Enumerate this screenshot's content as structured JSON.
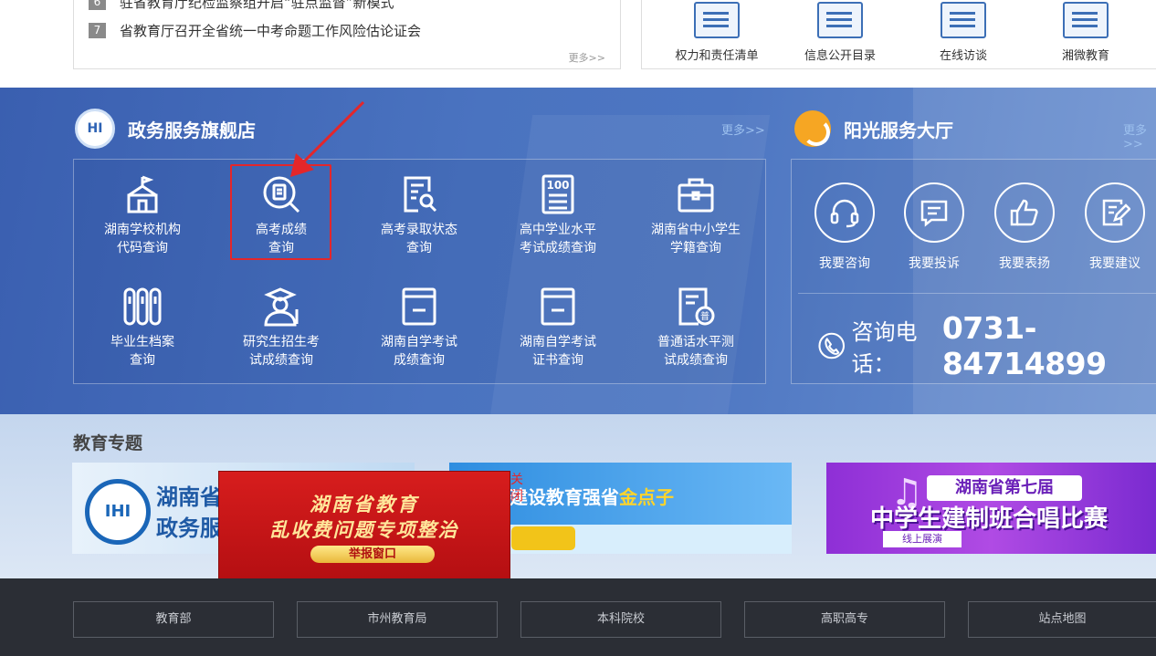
{
  "news": {
    "items": [
      {
        "num": "6",
        "text": "驻省教育厅纪检监察组开启“驻点监督”新模式"
      },
      {
        "num": "7",
        "text": "省教育厅召开全省统一中考命题工作风险估论证会"
      }
    ],
    "more": "更多>>"
  },
  "quick_links": [
    {
      "label": "权力和责任清单",
      "icon": "list-icon"
    },
    {
      "label": "信息公开目录",
      "icon": "eye-doc-icon"
    },
    {
      "label": "在线访谈",
      "icon": "chat-board-icon"
    },
    {
      "label": "湘微教育",
      "icon": "wechat-icon"
    }
  ],
  "gov_service": {
    "title": "政务服务旗舰店",
    "more": "更多>>",
    "items": [
      {
        "line1": "湖南学校机构",
        "line2": "代码查询",
        "icon": "school-icon"
      },
      {
        "line1": "高考成绩",
        "line2": "查询",
        "icon": "search-doc-icon"
      },
      {
        "line1": "高考录取状态",
        "line2": "查询",
        "icon": "doc-search-icon"
      },
      {
        "line1": "高中学业水平",
        "line2": "考试成绩查询",
        "icon": "score-100-icon"
      },
      {
        "line1": "湖南省中小学生",
        "line2": "学籍查询",
        "icon": "briefcase-icon"
      },
      {
        "line1": "毕业生档案",
        "line2": "查询",
        "icon": "archive-icon"
      },
      {
        "line1": "研究生招生考",
        "line2": "试成绩查询",
        "icon": "graduate-icon"
      },
      {
        "line1": "湖南自学考试",
        "line2": "成绩查询",
        "icon": "book-icon"
      },
      {
        "line1": "湖南自学考试",
        "line2": "证书查询",
        "icon": "certificate-icon"
      },
      {
        "line1": "普通话水平测",
        "line2": "试成绩查询",
        "icon": "mandarin-icon"
      }
    ]
  },
  "sunshine": {
    "title": "阳光服务大厅",
    "more": "更多>>",
    "items": [
      {
        "label": "我要咨询",
        "icon": "headset-icon"
      },
      {
        "label": "我要投诉",
        "icon": "message-icon"
      },
      {
        "label": "我要表扬",
        "icon": "thumbs-up-icon"
      },
      {
        "label": "我要建议",
        "icon": "edit-icon"
      }
    ],
    "phone_label": "咨询电话：",
    "phone_number": "0731-84714899"
  },
  "topics": {
    "title": "教育专题",
    "banner1_line1": "湖南省",
    "banner1_line2": "政务服",
    "banner2_prefix": "建设教育强省",
    "banner2_highlight": "金点子",
    "banner3_top": "湖南省第七届",
    "banner3_main": "中学生建制班合唱比赛",
    "banner3_sub": "线上展演"
  },
  "popup": {
    "line1": "湖南省教育",
    "line2": "乱收费问题专项整治",
    "button": "举报窗口",
    "close": "关闭"
  },
  "footer": {
    "links": [
      "教育部",
      "市州教育局",
      "本科院校",
      "高职高专",
      "站点地图"
    ]
  },
  "colors": {
    "band_blue": "#4a73c0",
    "highlight_red": "#e4262a",
    "footer_bg": "#2b2e35"
  }
}
